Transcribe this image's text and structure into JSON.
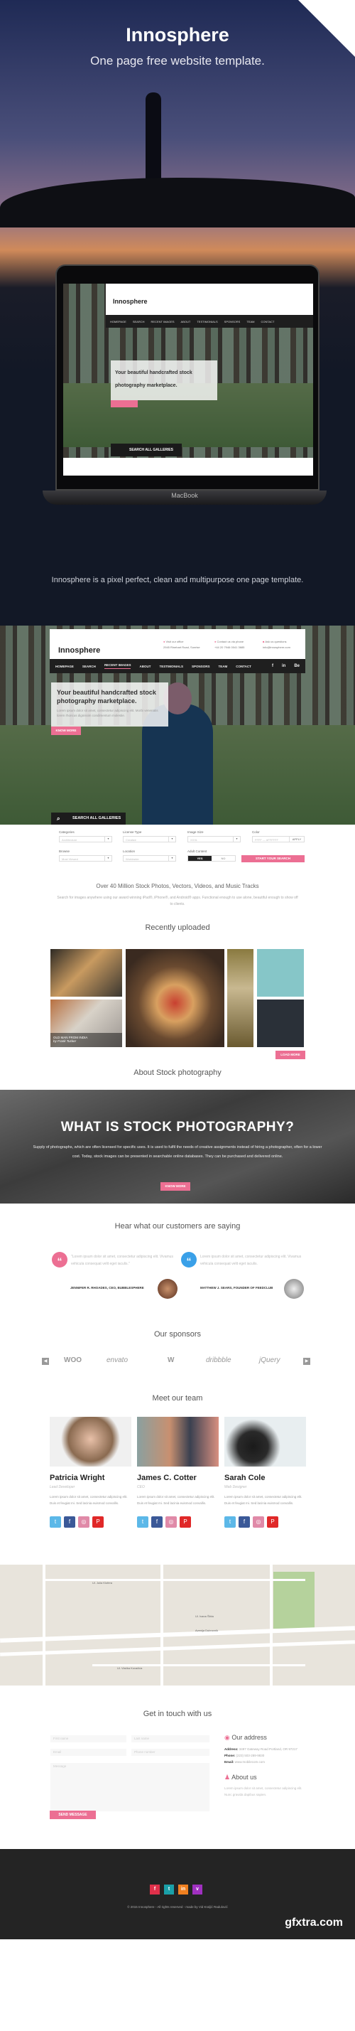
{
  "hero": {
    "title": "Innosphere",
    "subtitle": "One page free website template.",
    "device_label": "MacBook",
    "description": "Innosphere is a pixel perfect, clean and multipurpose one page template."
  },
  "site": {
    "logo": "Innosphere",
    "contacts": [
      {
        "label": "Visit our office",
        "value": "2945 Rinehart Road, Sunrise",
        "icon": "map-pin-icon"
      },
      {
        "label": "Contact us via phone",
        "value": "+44 20 7946 0041 3685",
        "icon": "phone-icon"
      },
      {
        "label": "Ask us questions",
        "value": "info@innosphere.com",
        "icon": "mail-icon"
      }
    ],
    "nav": [
      "HOMEPAGE",
      "SEARCH",
      "RECENT IMAGES",
      "ABOUT",
      "TESTIMONIALS",
      "SPONSORS",
      "TEAM",
      "CONTACT"
    ],
    "nav_active": "RECENT IMAGES",
    "nav_social": [
      "f",
      "in",
      "Be"
    ],
    "hero_heading": "Your beautiful handcrafted stock photography marketplace.",
    "hero_text": "Lorem ipsum dolor sit amet, consectetur adipiscing elit. Morbi venenatis lorem rhoncus dignissim condimentum molestie.",
    "know_more": "KNOW MORE",
    "search_all": "SEARCH ALL GALLERIES"
  },
  "search_form": {
    "categories": {
      "label": "Categories",
      "value": "Architecture"
    },
    "license": {
      "label": "License Type",
      "value": "Creative"
    },
    "size": {
      "label": "Image Size",
      "value": "XXXL"
    },
    "color": {
      "label": "Color",
      "value": "FFFF — #FFFFFF",
      "apply": "APPLY"
    },
    "browse": {
      "label": "Browse",
      "value": "Most Viewed"
    },
    "location": {
      "label": "Location",
      "value": "Worldwide"
    },
    "adult": {
      "label": "Adult Content",
      "yes": "YES",
      "no": "NO",
      "selected": "YES"
    },
    "start": "START YOUR SEARCH"
  },
  "intro": {
    "heading": "Over 40 Million Stock Photos, Vectors, Videos, and Music Tracks",
    "text": "Search for images anywhere using our award winning iPad®, iPhone®, and Android® apps. Functional enough to use alone, beautiful enough to show off to clients."
  },
  "recent": {
    "title": "Recently uploaded",
    "caption_title": "OLD MAN FROM INDIA",
    "caption_by": "by Frank Tucker",
    "load_more": "LOAD MORE"
  },
  "about": {
    "title": "About Stock photography",
    "heading": "WHAT IS STOCK PHOTOGRAPHY?",
    "text": "Supply of photographs, which are often licensed for specific uses. It is used to fulfil the needs of creative assignments instead of hiring a photographer, often for a lower cost. Today, stock images can be presented in searchable online databases. They can be purchased and delivered online.",
    "button": "KNOW MORE"
  },
  "testimonials": {
    "title": "Hear what our customers are saying",
    "items": [
      {
        "quote": "\"Lorem ipsum dolor sit amet, consectetur adipiscing elit. Vivamus vehicula consequat velit eget iaculis.\"",
        "author": "JENNIFER R. RHOADES, CEO, BUBBLESPHERE",
        "color": "#ec6f93"
      },
      {
        "quote": "Lorem ipsum dolor sit amet, consectetur adipiscing elit. Vivamus vehicula consequat velit eget iaculis.",
        "author": "MATTHEW J. SEARS, FOUNDER OF FEEDCLUB",
        "color": "#3aa0e8"
      }
    ]
  },
  "sponsors": {
    "title": "Our sponsors",
    "logos": [
      "WOO",
      "envato",
      "W",
      "dribbble",
      "jQuery"
    ]
  },
  "team": {
    "title": "Meet our team",
    "members": [
      {
        "name": "Patricia Wright",
        "role": "Lead Developer",
        "bio": "Lorem ipsum dolor sit amet, consectetur adipiscing elit. Duis et feugiat mi. Sed lacinia euismod convallis."
      },
      {
        "name": "James C. Cotter",
        "role": "CEO",
        "bio": "Lorem ipsum dolor sit amet, consectetur adipiscing elit. Duis et feugiat mi. Sed lacinia euismod convallis."
      },
      {
        "name": "Sarah Cole",
        "role": "Web Designer",
        "bio": "Lorem ipsum dolor sit amet, consectetur adipiscing elit. Duis et feugiat mi. Sed lacinia euismod convallis."
      }
    ]
  },
  "map": {
    "streets": [
      "Avenija Dubrovnik",
      "Ul. Ivana Šibla",
      "Ul. Julia Klofera",
      "Ul. Vlačka Kovačića"
    ]
  },
  "contact": {
    "title": "Get in touch with us",
    "first_name": "First name",
    "last_name": "Last name",
    "email": "Email",
    "phone": "Phone number",
    "message": "Message",
    "send": "SEND MESSAGE",
    "address_title": "Our address",
    "address_label": "Address:",
    "address_value": "3497 Gateway Road Portland, OR 97217",
    "phone_label": "Phone:",
    "phone_value": "(223) 503-289-9830",
    "email_label": "Email:",
    "email_value": "www.mobilecom.com",
    "about_title": "About us",
    "about_text": "Lorem ipsum dolor sit amet, consectetur adipiscing elit. Nunc gravida dapibus sapien."
  },
  "footer": {
    "social": [
      "f",
      "t",
      "in",
      "v"
    ],
    "copyright": "© 2015 Innosphere - All rights reserved - made by Vid Kraljić Radulović",
    "watermark": "gfxtra.com"
  }
}
